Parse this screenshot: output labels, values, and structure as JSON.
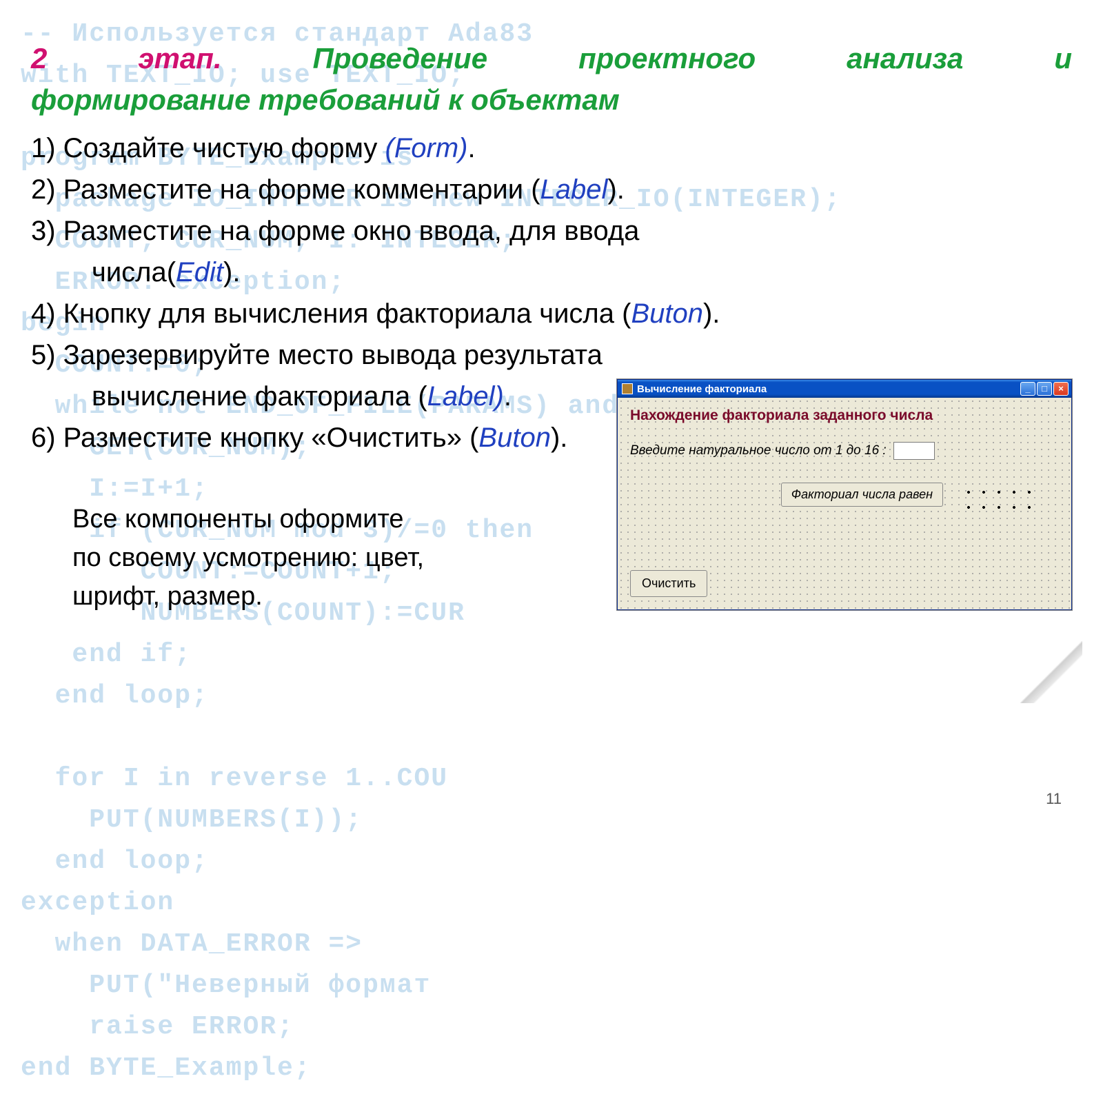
{
  "background_code": "-- Используется стандарт Ada83\nwith TEXT_IO; use TEXT_IO;\n\nprogram BYTE_Example is\n  package IO_INTEGER is new INTEGER_IO(INTEGER);\n  COUNT, CUR_NUM, I: INTEGER;\n  ERROR: exception;\nbegin\n  COUNT:=0;\n  while not END_OF_FILE(PARAMS) and I<=10 loop\n    GET(CUR_NUM);\n    I:=I+1;\n    if (CUR_NUM mod 3)/=0 then\n       COUNT:=COUNT+1;\n       NUMBERS(COUNT):=CUR\n   end if;\n  end loop;\n\n  for I in reverse 1..COU\n    PUT(NUMBERS(I));\n  end loop;\nexception\n  when DATA_ERROR =>\n    PUT(\"Неверный формат\n    raise ERROR;\nend BYTE_Example;",
  "title": {
    "stage": "2 этап",
    "dot": ".",
    "rest1": "Проведение проектного анализа и",
    "line2": "формирование требований к объектам"
  },
  "items": {
    "i1a": "1) Создайте чистую форму ",
    "i1b": "(Form)",
    "i1c": ".",
    "i2a": "2) Разместите на форме комментарии (",
    "i2b": "Label",
    "i2c": ").",
    "i3a": "3) Разместите на форме окно ввода, для ввода",
    "i3ind_a": "числа(",
    "i3ind_b": "Edit",
    "i3ind_c": ").",
    "i4a": "4) Кнопку для вычисления факториала числа (",
    "i4b": "Buton",
    "i4c": ").",
    "i5a": "5) Зарезервируйте место вывода результата",
    "i5ind_a": "вычисление факториала (",
    "i5ind_b": "Label)",
    "i5ind_c": ".",
    "i6a": "6) Разместите кнопку «Очистить» (",
    "i6b": "Buton",
    "i6c": ")."
  },
  "note": "Все компоненты оформите по своему усмотрению: цвет, шрифт, размер.",
  "window": {
    "title": "Вычисление факториала",
    "heading": "Нахождение факториала заданного числа",
    "prompt": "Введите натуральное число от 1 до 16 :",
    "factorial_button": "Факториал числа равен",
    "clear_button": "Очистить",
    "min_glyph": "_",
    "max_glyph": "□",
    "close_glyph": "×"
  },
  "page_number": "11"
}
